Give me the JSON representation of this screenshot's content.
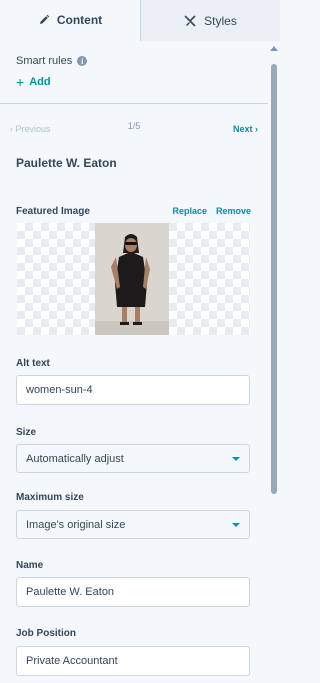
{
  "tabs": [
    {
      "label": "Content",
      "icon": "pencil-icon",
      "active": true
    },
    {
      "label": "Styles",
      "icon": "brush-icon",
      "active": false
    }
  ],
  "smart_rules": {
    "label": "Smart rules",
    "add_label": "Add"
  },
  "pager": {
    "prev_label": "Previous",
    "count": "1/5",
    "next_label": "Next"
  },
  "item": {
    "title": "Paulette W. Eaton"
  },
  "featured_image": {
    "label": "Featured Image",
    "replace_label": "Replace",
    "remove_label": "Remove"
  },
  "alt_text": {
    "label": "Alt text",
    "value": "women-sun-4"
  },
  "size": {
    "label": "Size",
    "value": "Automatically adjust"
  },
  "max_size": {
    "label": "Maximum size",
    "value": "Image's original size"
  },
  "name": {
    "label": "Name",
    "value": "Paulette W. Eaton"
  },
  "job_position": {
    "label": "Job Position",
    "value": "Private Accountant"
  },
  "colors": {
    "accent": "#0091ae",
    "text": "#33475b",
    "border": "#cbd6e2",
    "background": "#f5f8fa"
  }
}
